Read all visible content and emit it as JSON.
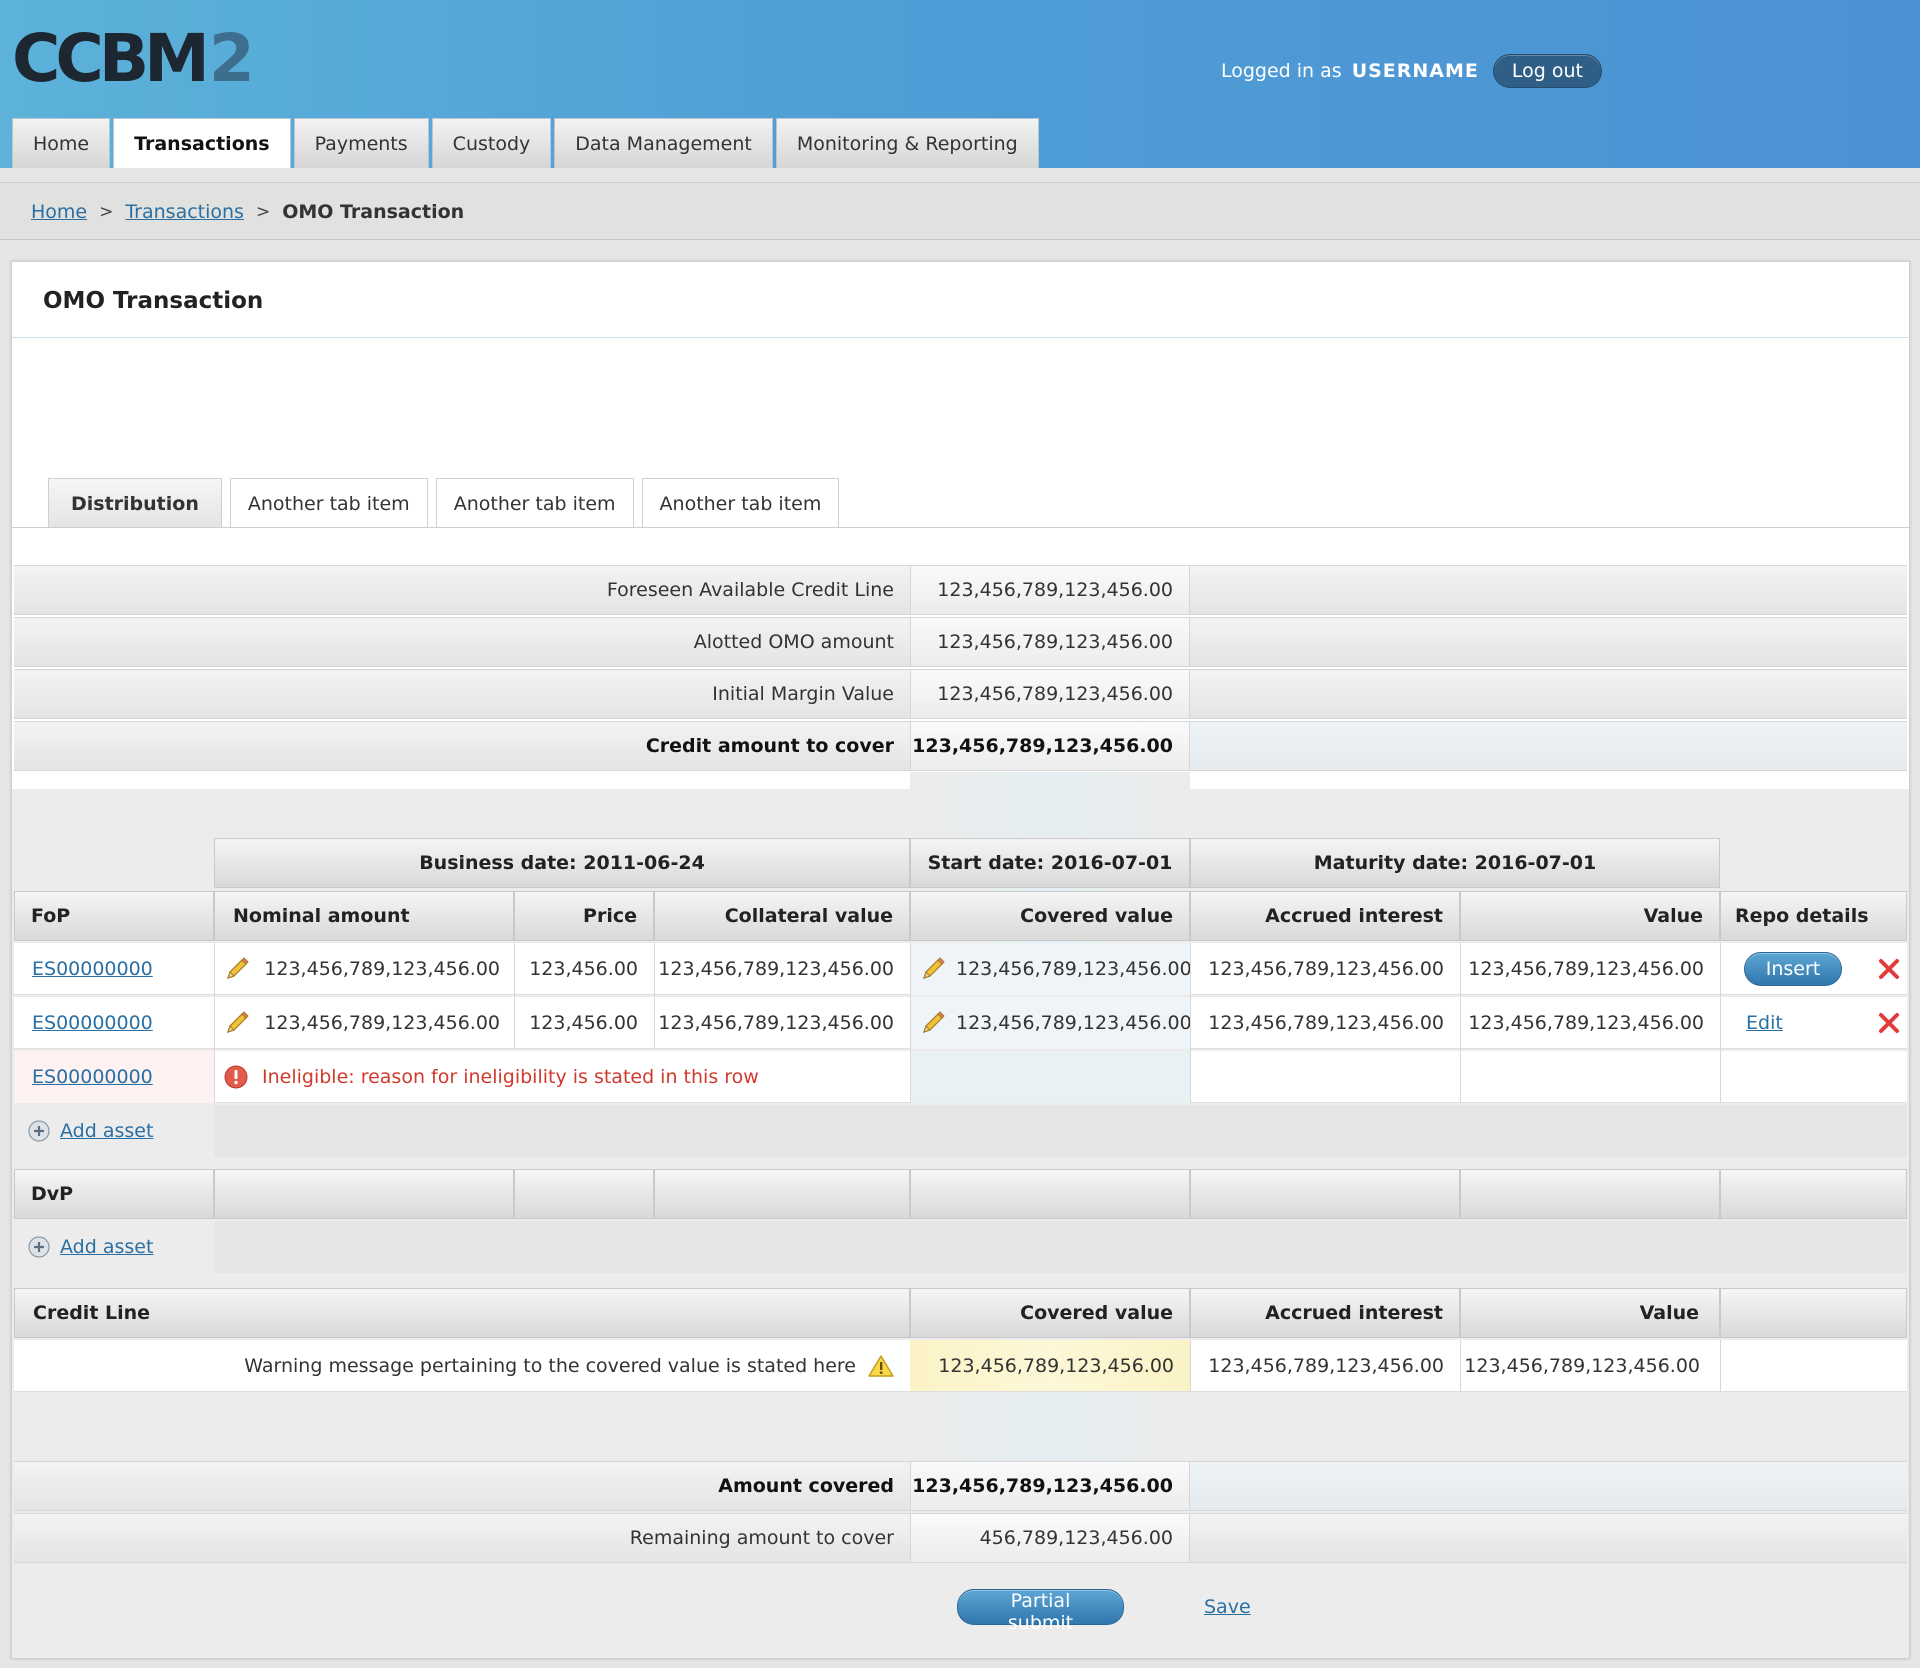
{
  "app": {
    "logo_main": "CCBM",
    "logo_sub": "2",
    "logged_in_as_label": "Logged in as",
    "username": "USERNAME",
    "logout_label": "Log out"
  },
  "nav": {
    "tabs": [
      {
        "label": "Home",
        "active": false
      },
      {
        "label": "Transactions",
        "active": true
      },
      {
        "label": "Payments",
        "active": false
      },
      {
        "label": "Custody",
        "active": false
      },
      {
        "label": "Data Management",
        "active": false
      },
      {
        "label": "Monitoring & Reporting",
        "active": false
      }
    ]
  },
  "breadcrumb": {
    "items": [
      {
        "label": "Home"
      },
      {
        "label": "Transactions"
      }
    ],
    "separator": ">",
    "current": "OMO Transaction"
  },
  "page": {
    "title": "OMO Transaction",
    "tabs": [
      {
        "label": "Distribution",
        "active": true
      },
      {
        "label": "Another tab item",
        "active": false
      },
      {
        "label": "Another tab item",
        "active": false
      },
      {
        "label": "Another tab item",
        "active": false
      }
    ]
  },
  "summary_top": {
    "rows": [
      {
        "label": "Foreseen Available Credit Line",
        "value": "123,456,789,123,456.00"
      },
      {
        "label": "Alotted OMO amount",
        "value": "123,456,789,123,456.00"
      },
      {
        "label": "Initial Margin Value",
        "value": "123,456,789,123,456.00"
      },
      {
        "label": "Credit amount to cover",
        "value": "123,456,789,123,456.00"
      }
    ]
  },
  "dates": {
    "business": "Business date: 2011-06-24",
    "start": "Start date: 2016-07-01",
    "maturity": "Maturity date: 2016-07-01"
  },
  "fop": {
    "section_label": "FoP",
    "columns": {
      "nominal": "Nominal amount",
      "price": "Price",
      "collateral": "Collateral value",
      "covered": "Covered value",
      "accrued": "Accrued interest",
      "value": "Value",
      "repo": "Repo details"
    },
    "rows": [
      {
        "isin": "ES00000000",
        "nominal": "123,456,789,123,456.00",
        "price": "123,456.00",
        "collateral": "123,456,789,123,456.00",
        "covered": "123,456,789,123,456.00",
        "accrued": "123,456,789,123,456.00",
        "value": "123,456,789,123,456.00",
        "repo_action": "Insert"
      },
      {
        "isin": "ES00000000",
        "nominal": "123,456,789,123,456.00",
        "price": "123,456.00",
        "collateral": "123,456,789,123,456.00",
        "covered": "123,456,789,123,456.00",
        "accrued": "123,456,789,123,456.00",
        "value": "123,456,789,123,456.00",
        "repo_action": "Edit"
      }
    ],
    "ineligible_row": {
      "isin": "ES00000000",
      "message": "Ineligible: reason for ineligibility is stated in this row"
    },
    "add_asset_label": "Add asset"
  },
  "dvp": {
    "section_label": "DvP",
    "add_asset_label": "Add asset"
  },
  "credit_line": {
    "section_label": "Credit Line",
    "columns": {
      "covered": "Covered value",
      "accrued": "Accrued interest",
      "value": "Value"
    },
    "warning": "Warning message pertaining to the covered value is stated here",
    "covered": "123,456,789,123,456.00",
    "accrued": "123,456,789,123,456.00",
    "value": "123,456,789,123,456.00"
  },
  "summary_bottom": {
    "amount_covered_label": "Amount covered",
    "amount_covered_value": "123,456,789,123,456.00",
    "remaining_label": "Remaining amount to cover",
    "remaining_value": "456,789,123,456.00"
  },
  "actions": {
    "partial_submit": "Partial submit",
    "save": "Save"
  },
  "colors": {
    "header_blue": "#4f9ed6",
    "link_blue": "#2a6fa3",
    "error_red": "#d0392b",
    "warning_yellow": "#f5d651",
    "delete_red": "#e23b3b"
  }
}
